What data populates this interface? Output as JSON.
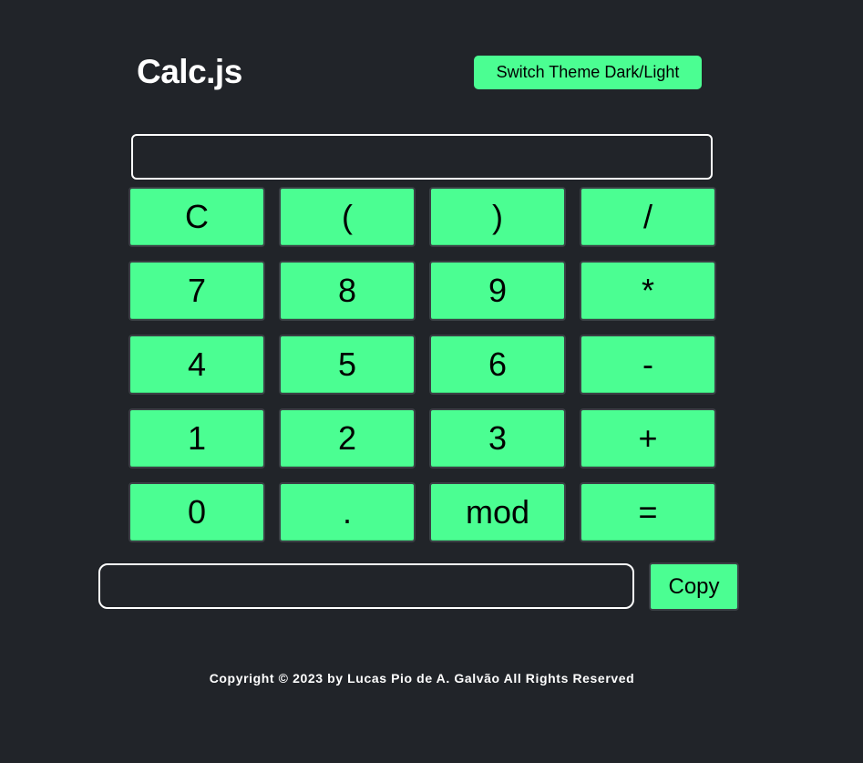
{
  "header": {
    "title": "Calc.js",
    "theme_button": "Switch Theme Dark/Light"
  },
  "display": {
    "value": ""
  },
  "keypad": {
    "keys": [
      "C",
      "(",
      ")",
      "/",
      "7",
      "8",
      "9",
      "*",
      "4",
      "5",
      "6",
      "-",
      "1",
      "2",
      "3",
      "+",
      "0",
      ".",
      "mod",
      "="
    ]
  },
  "result": {
    "value": "",
    "copy_label": "Copy"
  },
  "footer": {
    "text": "Copyright © 2023 by Lucas Pio de A. Galvão All Rights Reserved"
  },
  "colors": {
    "background": "#212429",
    "accent": "#4bfe92",
    "text_light": "#ffffff",
    "text_dark": "#000000"
  }
}
